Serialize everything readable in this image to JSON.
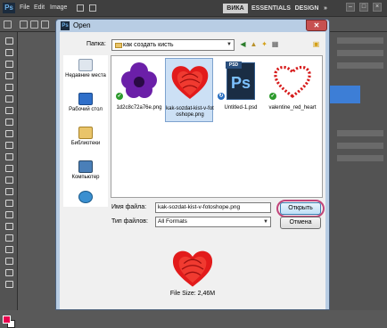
{
  "app": {
    "logo": "Ps",
    "menu": [
      "File",
      "Edit",
      "Image"
    ],
    "workspaces": [
      "ВИКА",
      "ESSENTIALS",
      "DESIGN"
    ],
    "overflow": "»"
  },
  "dialog": {
    "title": "Open",
    "close_label": "✕",
    "folder_label": "Папка:",
    "folder_value": "как создать кисть",
    "places": [
      {
        "label": "Недавние места",
        "icon": "recent-places-icon"
      },
      {
        "label": "Рабочий стол",
        "icon": "desktop-icon"
      },
      {
        "label": "Библиотеки",
        "icon": "libraries-icon"
      },
      {
        "label": "Компьютер",
        "icon": "computer-icon"
      },
      {
        "label": "",
        "icon": "network-icon"
      }
    ],
    "files": [
      {
        "name": "1d2c8c72a76e.png",
        "thumb": "purple-flower",
        "status": "synced"
      },
      {
        "name": "kak-sozdat-kist-v-fotoshope.png",
        "thumb": "red-rose-heart",
        "status": "none"
      },
      {
        "name": "Untitled-1.psd",
        "thumb": "psd-file",
        "psd_tag": "PSD",
        "psd_letters": "Ps",
        "status": "sync"
      },
      {
        "name": "valentine_red_heart",
        "thumb": "dotted-heart",
        "status": "synced"
      }
    ],
    "filename_label": "Имя файла:",
    "filename_value": "kak-sozdat-kist-v-fotoshope.png",
    "filetype_label": "Тип файлов:",
    "filetype_value": "All Formats",
    "open_label": "Открыть",
    "cancel_label": "Отмена",
    "file_size": "File Size: 2,46M"
  },
  "colors": {
    "foreground": "#e8004e",
    "background": "#ffffff",
    "dialog_frame": "#b8cde4",
    "highlight": "#c2457a"
  }
}
